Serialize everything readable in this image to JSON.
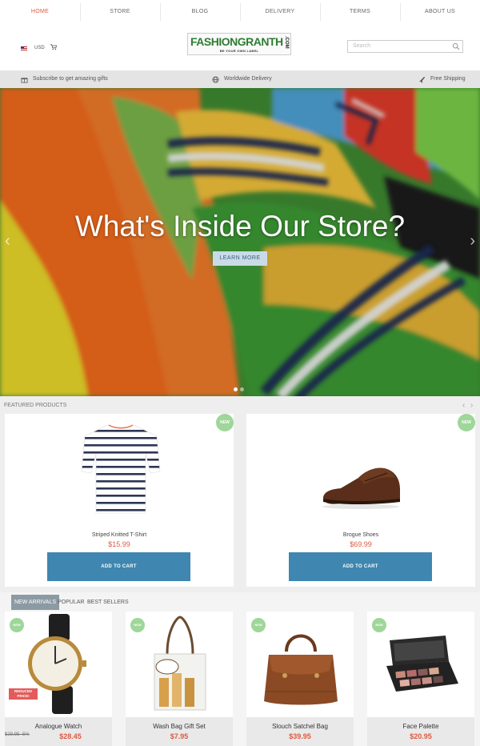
{
  "nav": {
    "items": [
      {
        "label": "HOME"
      },
      {
        "label": "STORE"
      },
      {
        "label": "BLOG"
      },
      {
        "label": "DELIVERY"
      },
      {
        "label": "TERMS"
      },
      {
        "label": "ABOUT US"
      }
    ]
  },
  "header": {
    "currency": "USD",
    "logo_main": "FASHIONGRANTH",
    "logo_suffix": ".COM",
    "logo_tagline": "BE YOUR OWN LABEL",
    "search_placeholder": "Search"
  },
  "info_bar": {
    "subscribe": "Subscribe to get amazing gifts",
    "delivery": "Worldwide Delivery",
    "shipping": "Free Shipping"
  },
  "hero": {
    "title": "What's Inside Our Store?",
    "button": "LEARN MORE",
    "slide_count": 2,
    "active_slide": 1
  },
  "featured": {
    "title": "FEATURED PRODUCTS",
    "products": [
      {
        "name": "Striped Knitted T-Shirt",
        "price": "$15.99",
        "badge": "NEW",
        "cta": "ADD TO CART"
      },
      {
        "name": "Brogue Shoes",
        "price": "$69.99",
        "badge": "NEW",
        "cta": "ADD TO CART"
      }
    ]
  },
  "tabs": {
    "items": [
      {
        "label": "NEW ARRIVALS"
      },
      {
        "label": "POPULAR"
      },
      {
        "label": "BEST SELLERS"
      }
    ],
    "products": [
      {
        "name": "Analogue Watch",
        "price": "$28.45",
        "old_price": "$29.95 -5%",
        "badge": "NEW",
        "flag": "REDUCED PRICE!"
      },
      {
        "name": "Wash Bag Gift Set",
        "price": "$7.95",
        "badge": "NEW"
      },
      {
        "name": "Slouch Satchel Bag",
        "price": "$39.95",
        "badge": "NEW"
      },
      {
        "name": "Face Palette",
        "price": "$20.95",
        "badge": "NEW"
      }
    ]
  },
  "colors": {
    "accent": "#e0593e",
    "button": "#3f86b0",
    "badge": "#9fd69a",
    "tab_active": "#8c9aa3"
  }
}
